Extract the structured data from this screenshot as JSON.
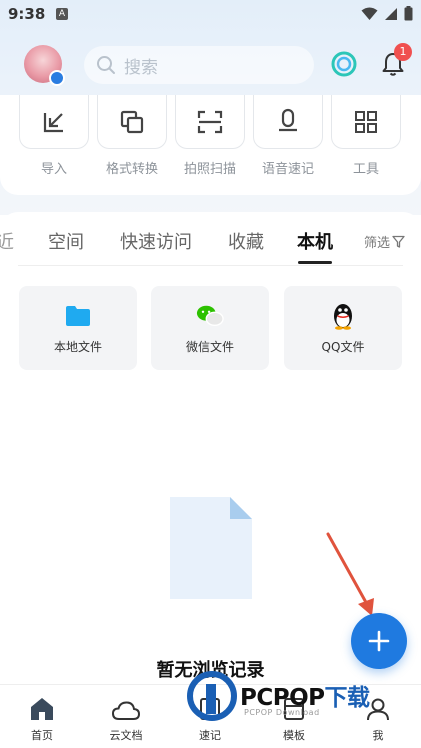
{
  "status_bar": {
    "time": "9:38",
    "notification_letter": "A",
    "icons": [
      "wifi-icon",
      "signal-icon",
      "battery-icon"
    ]
  },
  "header": {
    "search_placeholder": "搜索",
    "notification_count": "1"
  },
  "tools": [
    {
      "label": "导入",
      "icon": "import-icon"
    },
    {
      "label": "格式转换",
      "icon": "format-convert-icon"
    },
    {
      "label": "拍照扫描",
      "icon": "scan-icon"
    },
    {
      "label": "语音速记",
      "icon": "microphone-icon"
    },
    {
      "label": "工具",
      "icon": "grid-icon"
    }
  ],
  "tabs": [
    {
      "label": "近"
    },
    {
      "label": "空间"
    },
    {
      "label": "快速访问"
    },
    {
      "label": "收藏"
    },
    {
      "label": "本机",
      "active": true
    }
  ],
  "filter_label": "筛选",
  "sources": [
    {
      "label": "本地文件",
      "icon": "folder-icon"
    },
    {
      "label": "微信文件",
      "icon": "wechat-icon"
    },
    {
      "label": "QQ文件",
      "icon": "qq-icon"
    }
  ],
  "empty_state": "暂无浏览记录",
  "bottom_nav": [
    {
      "label": "首页",
      "icon": "home-icon"
    },
    {
      "label": "云文档",
      "icon": "cloud-icon"
    },
    {
      "label": "速记",
      "icon": "note-icon"
    },
    {
      "label": "模板",
      "icon": "template-icon"
    },
    {
      "label": "我",
      "icon": "profile-icon"
    }
  ],
  "watermark": {
    "text_main": "PCPOP",
    "text_cn": "下载",
    "sub": "PCPOP Download"
  },
  "colors": {
    "accent": "#1f7ae0",
    "badge": "#f05050",
    "arrow": "#e0533d"
  }
}
